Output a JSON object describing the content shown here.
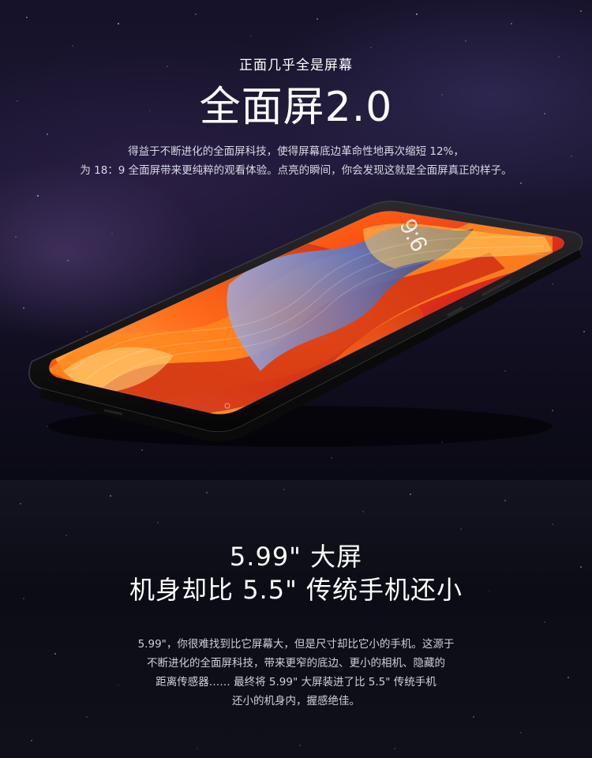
{
  "hero": {
    "kicker": "正面几乎全是屏幕",
    "title": "全面屏2.0",
    "desc_lines": [
      "得益于不断进化的全面屏科技，使得屏幕底边革命性地再次缩短 12%，",
      "为 18：9 全面屏带来更纯粹的观看体验。点亮的瞬间，你会发现这就是全面屏真正的样子。"
    ],
    "phone_clock": "9:6"
  },
  "section2": {
    "title_lines": [
      "5.99\" 大屏",
      "机身却比 5.5\" 传统手机还小"
    ],
    "desc_lines": [
      "5.99\"，你很难找到比它屏幕大，但是尺寸却比它小的手机。这源于",
      "不断进化的全面屏科技，带来更窄的底边、更小的相机、隐藏的",
      "距离传感器…… 最终将 5.99\" 大屏装进了比 5.5\" 传统手机",
      "还小的机身内，握感绝佳。"
    ]
  },
  "colors": {
    "background": "#0b0b14",
    "text_primary": "#ffffff",
    "text_secondary": "#d8d8e2",
    "wallpaper_orange": "#ff6a1a",
    "wallpaper_red": "#d8341c",
    "wallpaper_blue": "#6a8bd8",
    "phone_body": "#111111"
  }
}
